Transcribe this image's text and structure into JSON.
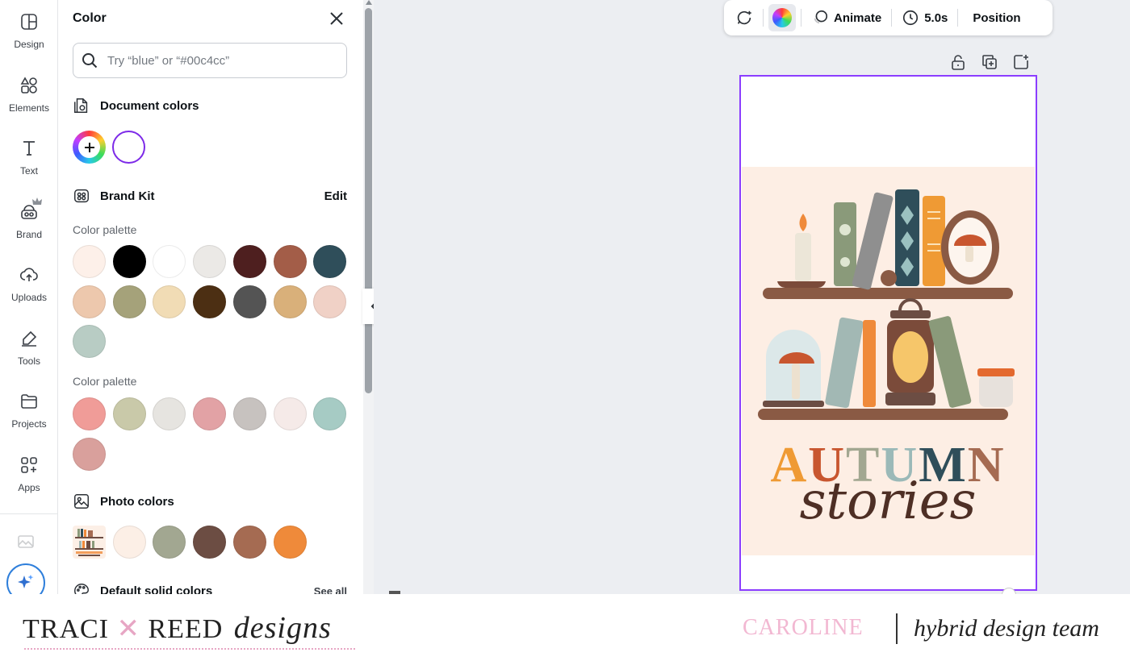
{
  "rail": {
    "items": [
      {
        "label": "Design",
        "icon": "design-icon"
      },
      {
        "label": "Elements",
        "icon": "elements-icon"
      },
      {
        "label": "Text",
        "icon": "text-icon"
      },
      {
        "label": "Brand",
        "icon": "brand-icon"
      },
      {
        "label": "Uploads",
        "icon": "uploads-icon"
      },
      {
        "label": "Tools",
        "icon": "tools-icon"
      },
      {
        "label": "Projects",
        "icon": "projects-icon"
      },
      {
        "label": "Apps",
        "icon": "apps-icon"
      }
    ]
  },
  "panel": {
    "title": "Color",
    "search_placeholder": "Try “blue” or “#00c4cc”",
    "document_colors": {
      "title": "Document colors",
      "accent": "#7d2ae8"
    },
    "brand_kit": {
      "title": "Brand Kit",
      "edit_label": "Edit"
    },
    "palette_1": {
      "label": "Color palette",
      "colors": [
        "#fdf0e9",
        "#000000",
        "#ffffff",
        "#ebe9e6",
        "#4e1f1f",
        "#a35d48",
        "#2f4e5a",
        "#edc8ad",
        "#a5a27a",
        "#f1dcb5",
        "#4c2f13",
        "#545454",
        "#d9b07a",
        "#f0d1c6",
        "#b8ccc4"
      ]
    },
    "palette_2": {
      "label": "Color palette",
      "colors": [
        "#f09c98",
        "#c9c9a9",
        "#e6e4e0",
        "#e2a2a5",
        "#c7c2bf",
        "#f5eae8",
        "#a6cbc4",
        "#d9a09c"
      ]
    },
    "photo_colors": {
      "title": "Photo colors",
      "colors": [
        "#fcefe6",
        "#a2a791",
        "#6c4d43",
        "#a56b52",
        "#ef8a3a"
      ]
    },
    "default_solid": {
      "title": "Default solid colors",
      "see_all_label": "See all"
    }
  },
  "toolbar": {
    "animate_label": "Animate",
    "duration_label": "5.0s",
    "position_label": "Position"
  },
  "canvas": {
    "art_title": "AUTUMN",
    "art_script": "stories",
    "colors": {
      "bg": "#fdeee4",
      "selection": "#8b3dff"
    }
  },
  "footer": {
    "brand_name_1": "TRACI",
    "brand_name_2": "REED",
    "brand_script": "designs",
    "member_name": "CAROLINE",
    "team": "hybrid design team"
  }
}
